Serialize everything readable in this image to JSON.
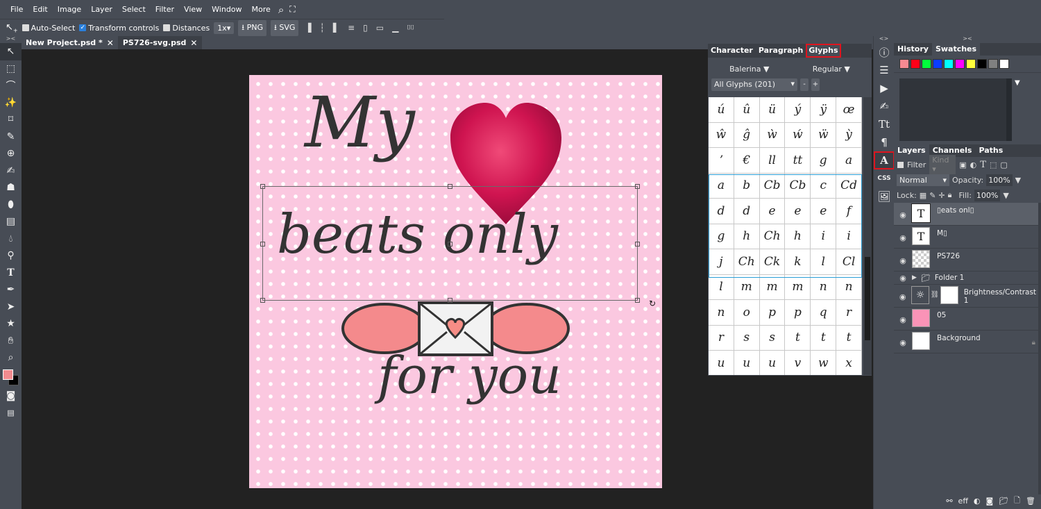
{
  "menu": {
    "items": [
      "File",
      "Edit",
      "Image",
      "Layer",
      "Select",
      "Filter",
      "View",
      "Window",
      "More"
    ],
    "search_icon": "search-icon",
    "fullscreen_icon": "fullscreen-icon"
  },
  "options": {
    "tool_icon": "move-tool-icon",
    "auto_select": {
      "label": "Auto-Select",
      "checked": false
    },
    "transform_controls": {
      "label": "Transform controls",
      "checked": true
    },
    "distances": {
      "label": "Distances",
      "checked": false
    },
    "scale": "1x",
    "png_label": "PNG",
    "svg_label": "SVG",
    "align_icons": [
      "align-left-icon",
      "align-center-h-icon",
      "align-right-icon",
      "distribute-h-icon",
      "align-top-icon",
      "align-middle-v-icon",
      "align-bottom-icon",
      "distribute-v-icon"
    ]
  },
  "tabs": [
    {
      "label": "New Project.psd *",
      "active": false
    },
    {
      "label": "PS726-svg.psd",
      "active": true
    }
  ],
  "tools": [
    "move",
    "marquee",
    "lasso",
    "magic-wand",
    "crop",
    "eyedropper",
    "healing",
    "brush",
    "clone-stamp",
    "eraser",
    "gradient",
    "blur",
    "dodge",
    "type",
    "pen",
    "path-select",
    "shape",
    "hand",
    "zoom"
  ],
  "colors": {
    "foreground": "#f28b8f",
    "background": "#000000"
  },
  "artboard": {
    "line1": "My",
    "line2": "beats only",
    "line3": "for you",
    "background_color": "#fbc8e0",
    "heart_color": "#d3174f"
  },
  "glyphs_panel": {
    "tabs": [
      "Character",
      "Paragraph",
      "Glyphs"
    ],
    "active_tab": "Glyphs",
    "font": "Balerina ▼",
    "style": "Regular ▼",
    "set": "All Glyphs (201)",
    "minus": "-",
    "plus": "+",
    "glyphs": [
      "ú",
      "û",
      "ü",
      "ý",
      "ÿ",
      "œ",
      "ŵ",
      "ĝ",
      "ẁ",
      "ẃ",
      "ẅ",
      "ỳ",
      "ʼ",
      "€",
      "ll",
      "tt",
      "g",
      "a",
      "a",
      "b",
      "Cb",
      "Cb",
      "c",
      "Cd",
      "d",
      "d",
      "e",
      "e",
      "e",
      "f",
      "g",
      "h",
      "Ch",
      "h",
      "i",
      "i",
      "j",
      "Ch",
      "Ck",
      "k",
      "l",
      "Cl",
      "l",
      "m",
      "m",
      "m",
      "n",
      "n",
      "n",
      "o",
      "p",
      "p",
      "q",
      "r",
      "r",
      "s",
      "s",
      "t",
      "t",
      "t",
      "u",
      "u",
      "u",
      "v",
      "w",
      "x"
    ]
  },
  "icon_strip": [
    "info-icon",
    "adjustments-icon",
    "play-icon",
    "brush-settings-icon",
    "character-icon",
    "paragraph-icon",
    "glyphs-icon",
    "css-icon",
    "image-icon"
  ],
  "icon_strip_labels": {
    "css": "CSS"
  },
  "history_panel": {
    "tabs": [
      "History",
      "Swatches"
    ],
    "active_tab": "Swatches",
    "swatches": [
      "#f78a92",
      "#ff0018",
      "#00ff3c",
      "#0a3dff",
      "#00ffff",
      "#ff00ff",
      "#ffff3c",
      "#000000",
      "#808080",
      "#ffffff"
    ]
  },
  "layers_panel": {
    "tabs": [
      "Layers",
      "Channels",
      "Paths"
    ],
    "active_tab": "Layers",
    "filter_label": "Filter",
    "kind_label": "Kind",
    "blend_mode": "Normal",
    "opacity_label": "Opacity:",
    "opacity": "100%",
    "lock_label": "Lock:",
    "fill_label": "Fill:",
    "fill": "100%",
    "layers": [
      {
        "name": "▯eats onl▯",
        "type": "text",
        "selected": true
      },
      {
        "name": "M▯",
        "type": "text",
        "selected": false
      },
      {
        "name": "PS726",
        "type": "smart",
        "selected": false
      },
      {
        "name": "Folder 1",
        "type": "folder",
        "selected": false
      },
      {
        "name": "Brightness/Contrast 1",
        "type": "adjustment",
        "selected": false
      },
      {
        "name": "05",
        "type": "smart-pink",
        "selected": false
      },
      {
        "name": "Background",
        "type": "background",
        "locked": true,
        "selected": false
      }
    ],
    "footer": {
      "fx_label": "eff"
    }
  }
}
